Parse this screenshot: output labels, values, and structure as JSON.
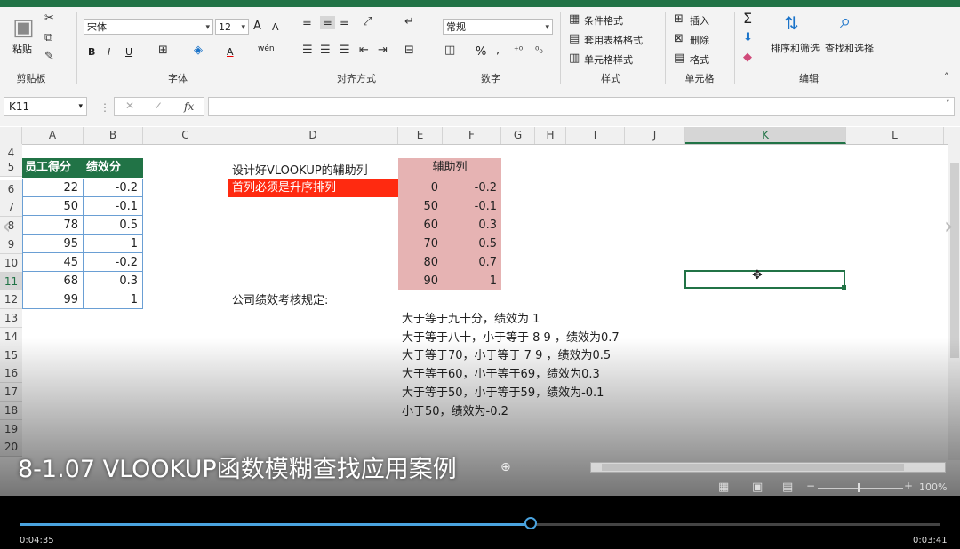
{
  "ribbon": {
    "clipboard": {
      "paste": "粘贴",
      "label": "剪贴板"
    },
    "font": {
      "name": "宋体",
      "size": "12",
      "label": "字体",
      "bold": "B",
      "italic": "I",
      "underline": "U",
      "grow": "A",
      "shrink": "A",
      "color": "A",
      "wen": "wén"
    },
    "align": {
      "label": "对齐方式"
    },
    "number": {
      "format": "常规",
      "label": "数字",
      "percent": "%",
      "comma": ","
    },
    "styles": {
      "cond": "条件格式",
      "table": "套用表格格式",
      "cell": "单元格样式",
      "label": "样式"
    },
    "cells": {
      "insert": "插入",
      "delete": "删除",
      "format": "格式",
      "label": "单元格"
    },
    "editing": {
      "sort": "排序和筛选",
      "find": "查找和选择",
      "label": "编辑",
      "sigma": "Σ"
    }
  },
  "formula_bar": {
    "name_box": "K11",
    "fx": "fx",
    "value": ""
  },
  "columns": [
    "A",
    "B",
    "C",
    "D",
    "E",
    "F",
    "G",
    "H",
    "I",
    "J",
    "K",
    "L"
  ],
  "rows": [
    "4",
    "5",
    "6",
    "7",
    "8",
    "9",
    "10",
    "11",
    "12",
    "13",
    "14",
    "15",
    "16",
    "17",
    "18",
    "19",
    "20"
  ],
  "table_main": {
    "headers": [
      "员工得分",
      "绩效分"
    ],
    "rows": [
      [
        "22",
        "-0.2"
      ],
      [
        "50",
        "-0.1"
      ],
      [
        "78",
        "0.5"
      ],
      [
        "95",
        "1"
      ],
      [
        "45",
        "-0.2"
      ],
      [
        "68",
        "0.3"
      ],
      [
        "99",
        "1"
      ]
    ]
  },
  "helper": {
    "title": "设计好VLOOKUP的辅助列",
    "warning": "首列必须是升序排列",
    "header": "辅助列",
    "rows": [
      [
        "0",
        "-0.2"
      ],
      [
        "50",
        "-0.1"
      ],
      [
        "60",
        "0.3"
      ],
      [
        "70",
        "0.5"
      ],
      [
        "80",
        "0.7"
      ],
      [
        "90",
        "1"
      ]
    ]
  },
  "rules": {
    "title": "公司绩效考核规定:",
    "lines": [
      "大于等于九十分，绩效为 1",
      "大于等于八十，小于等于 8 9 ，绩效为0.7",
      "大于等于70，小于等于 7 9 ，绩效为0.5",
      "大于等于60，小于等于69，绩效为0.3",
      "大于等于50，小于等于59，绩效为-0.1",
      "小于50，绩效为-0.2"
    ]
  },
  "video": {
    "subtitle": "8-1.07 VLOOKUP函数模糊查找应用案例",
    "time_current": "0:04:35",
    "time_total": "0:03:41",
    "progress": 0.555
  },
  "status": {
    "zoom": "100%"
  },
  "colors": {
    "header_green": "#217346",
    "warning_red": "#ff2a10",
    "helper_pink": "#e6b3b3",
    "progress_blue": "#4aa3df"
  }
}
